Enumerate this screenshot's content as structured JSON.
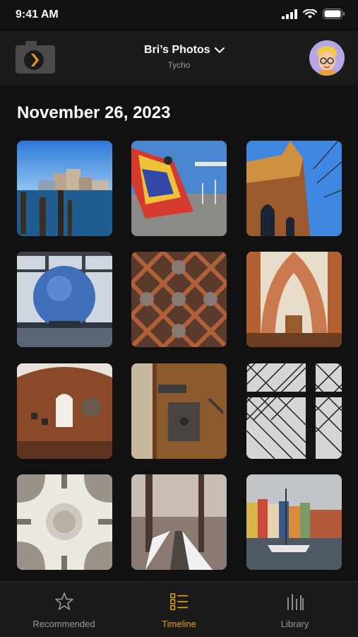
{
  "status": {
    "time": "9:41 AM",
    "icons": [
      "signal-icon",
      "wifi-icon",
      "battery-icon"
    ]
  },
  "header": {
    "title": "Bri’s Photos",
    "subtitle": "Tycho",
    "logo": "camera-logo-icon",
    "dropdown_icon": "chevron-down-icon",
    "avatar": "user-avatar"
  },
  "section": {
    "date": "November 26, 2023"
  },
  "photos": [
    {
      "subject": "harbor-buildings"
    },
    {
      "subject": "colorful-flag-bridge"
    },
    {
      "subject": "brick-church-tower"
    },
    {
      "subject": "glass-orb-window"
    },
    {
      "subject": "ornate-wood-lattice"
    },
    {
      "subject": "cathedral-nave"
    },
    {
      "subject": "chapel-arched-window"
    },
    {
      "subject": "old-door-lock"
    },
    {
      "subject": "leaded-window-grid"
    },
    {
      "subject": "ceiling-dome"
    },
    {
      "subject": "snowy-tree-path"
    },
    {
      "subject": "nyhavn-canal"
    }
  ],
  "tabs": [
    {
      "label": "Recommended",
      "icon": "star-icon",
      "active": false
    },
    {
      "label": "Timeline",
      "icon": "timeline-list-icon",
      "active": true
    },
    {
      "label": "Library",
      "icon": "library-icon",
      "active": false
    }
  ],
  "colors": {
    "accent": "#e5a00d",
    "background": "#111111",
    "header": "#1b1b1b"
  }
}
